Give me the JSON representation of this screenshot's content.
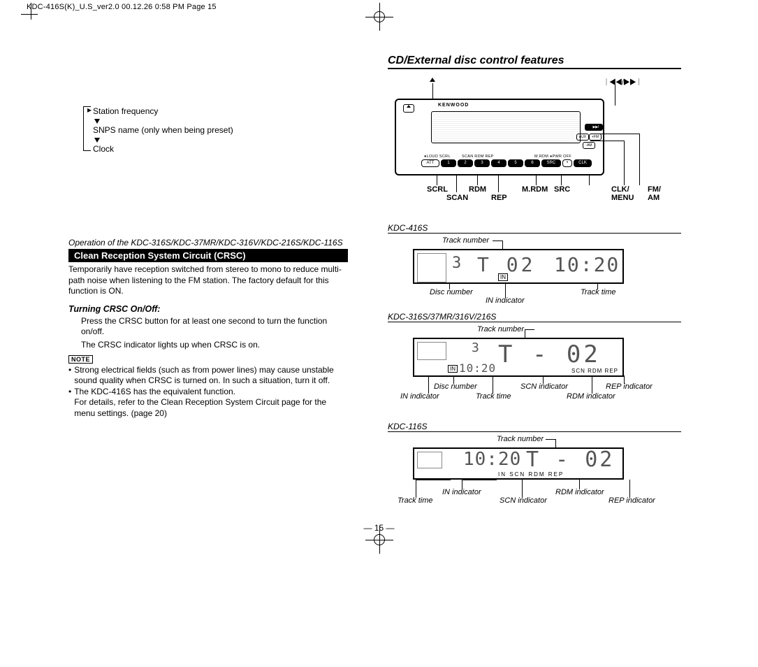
{
  "header_line": "KDC-416S(K)_U.S_ver2.0  00.12.26 0:58 PM  Page 15",
  "section_title": "CD/External disc control features",
  "cycle": {
    "item1": "Station frequency",
    "item2": "SNPS name (only when being preset)",
    "item3": "Clock"
  },
  "left": {
    "operation_line": "Operation of the KDC-316S/KDC-37MR/KDC-316V/KDC-216S/KDC-116S",
    "crsc_heading": "Clean Reception System Circuit (CRSC)",
    "crsc_body": "Temporarily have reception switched from stereo to mono to reduce multi-path noise when listening to the FM station. The factory default for this function is ON.",
    "sub_heading": "Turning CRSC On/Off:",
    "sub_body1": "Press the CRSC button for at least one second to turn the function on/off.",
    "sub_body2": "The CRSC indicator lights up when CRSC is on.",
    "note_label": "NOTE",
    "bullet1": "Strong electrical fields (such as from power lines) may cause unstable sound quality when CRSC is turned on. In such a situation, turn it off.",
    "bullet2a": "The KDC-416S has the equivalent function.",
    "bullet2b": "For details, refer to the Clean Reception System Circuit page for the menu settings. (page 20)"
  },
  "radio": {
    "brand": "KENWOOD",
    "callouts": {
      "scrl": "SCRL",
      "scan": "SCAN",
      "rdm": "RDM",
      "rep": "REP",
      "mrdm": "M.RDM",
      "src": "SRC",
      "clk": "CLK/",
      "menu": "MENU",
      "fm": "FM/",
      "am": "AM",
      "eject": "▲",
      "seek": "I◀◀/▶▶I"
    },
    "presets": {
      "p1": "1",
      "p2": "2",
      "p3": "3",
      "p4": "4",
      "p5": "5",
      "p6": "6",
      "src": "SRC",
      "clk": "CLK",
      "att": "ATT"
    },
    "right_btns": {
      "prev": "I◀◀",
      "next": "▶▶I",
      "aux": "AUX",
      "fm": "+FM",
      "am": "-AM"
    }
  },
  "displays": {
    "d1": {
      "title": "KDC-416S",
      "anno_track_num": "Track number",
      "anno_disc_num": "Disc number",
      "anno_in": "IN indicator",
      "anno_track_time": "Track time",
      "lcd_disc": "3",
      "lcd_track": "T 02",
      "lcd_time": "10:20",
      "lcd_in": "IN"
    },
    "d2": {
      "title": "KDC-316S/37MR/316V/216S",
      "anno_track_num": "Track number",
      "anno_disc_num": "Disc number",
      "anno_in": "IN indicator",
      "anno_track_time": "Track time",
      "anno_scn": "SCN indicator",
      "anno_rdm": "RDM indicator",
      "anno_rep": "REP indicator",
      "lcd_disc": "3",
      "lcd_track": "T - 02",
      "lcd_time": "10:20",
      "lcd_tags": "SCN  RDM  REP",
      "lcd_in": "IN"
    },
    "d3": {
      "title": "KDC-116S",
      "anno_track_num": "Track number",
      "anno_in": "IN indicator",
      "anno_track_time": "Track time",
      "anno_scn": "SCN indicator",
      "anno_rdm": "RDM indicator",
      "anno_rep": "REP indicator",
      "lcd_time": "10:20",
      "lcd_track": "T - 02",
      "lcd_tags": "IN        SCN RDM REP"
    }
  },
  "page_number": "— 15 —"
}
